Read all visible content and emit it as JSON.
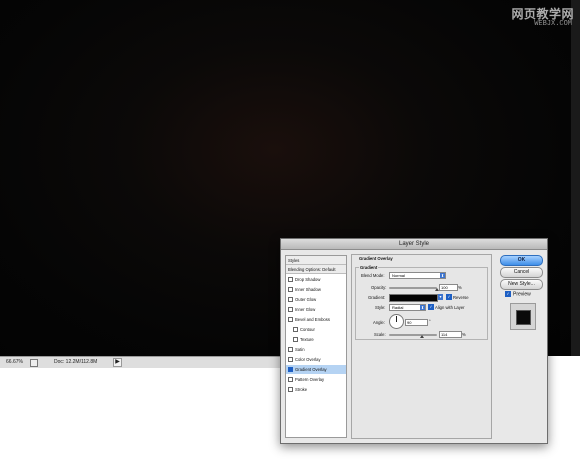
{
  "watermark": {
    "line1": "网页教学网",
    "line2": "WEBJX.COM"
  },
  "statusbar": {
    "zoom": "66.67%",
    "doc": "Doc: 12.2M/112.8M",
    "arrow": "▶"
  },
  "dialog": {
    "title": "Layer Style",
    "styles_list": [
      {
        "label": "Styles",
        "header": true
      },
      {
        "label": "Blending Options: Default",
        "header": true
      },
      {
        "label": "Drop Shadow",
        "checked": false
      },
      {
        "label": "Inner Shadow",
        "checked": false
      },
      {
        "label": "Outer Glow",
        "checked": false
      },
      {
        "label": "Inner Glow",
        "checked": false
      },
      {
        "label": "Bevel and Emboss",
        "checked": false
      },
      {
        "label": "Contour",
        "checked": false,
        "indent": true
      },
      {
        "label": "Texture",
        "checked": false,
        "indent": true
      },
      {
        "label": "Satin",
        "checked": false
      },
      {
        "label": "Color Overlay",
        "checked": false
      },
      {
        "label": "Gradient Overlay",
        "checked": true,
        "selected": true
      },
      {
        "label": "Pattern Overlay",
        "checked": false
      },
      {
        "label": "Stroke",
        "checked": false
      }
    ],
    "panel": {
      "section_title": "Gradient Overlay",
      "group_title": "Gradient",
      "blend_mode_label": "Blend Mode:",
      "blend_mode_value": "Normal",
      "opacity_label": "Opacity:",
      "opacity_value": "100",
      "opacity_unit": "%",
      "gradient_label": "Gradient:",
      "reverse_label": "Reverse",
      "style_label": "Style:",
      "style_value": "Radial",
      "align_label": "Align with Layer",
      "angle_label": "Angle:",
      "angle_value": "90",
      "angle_unit": "°",
      "scale_label": "Scale:",
      "scale_value": "114",
      "scale_unit": "%"
    },
    "buttons": {
      "ok": "OK",
      "cancel": "Cancel",
      "new_style": "New Style...",
      "preview": "Preview"
    },
    "check_glyph": "✓",
    "chevron_glyph": "⬍",
    "gradient_arrow_glyph": "▾"
  },
  "colors": {
    "accent": "#3c74cf",
    "selection": "#b5d3f3",
    "canvas": "#050505"
  }
}
